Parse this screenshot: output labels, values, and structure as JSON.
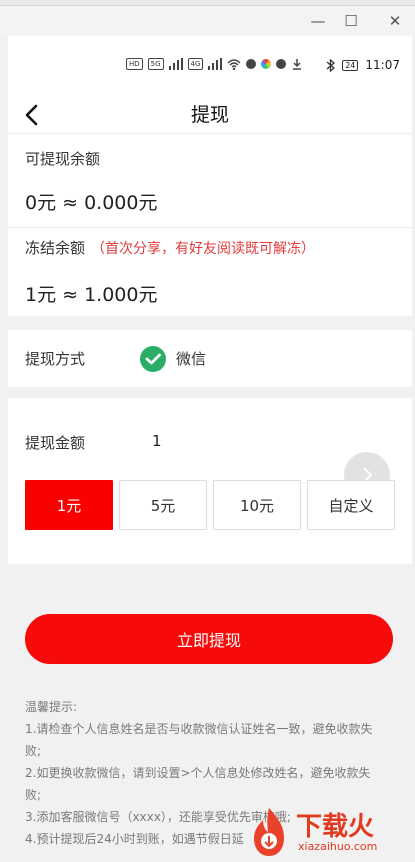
{
  "window": {
    "minimize": "—",
    "maximize": "☐",
    "close": "✕"
  },
  "status_bar": {
    "hd": "HD",
    "net1": "5G",
    "net2": "4G",
    "battery": "24",
    "time": "11:07"
  },
  "nav": {
    "title": "提现"
  },
  "balance": {
    "available_label": "可提现余额",
    "available_value": "0元 ≈ 0.000元",
    "frozen_label": "冻结余额",
    "frozen_note": "（首次分享，有好友阅读既可解冻）",
    "frozen_value": "1元 ≈ 1.000元"
  },
  "method": {
    "label": "提现方式",
    "value": "微信",
    "icon": "wechat-icon",
    "icon_color": "#2aae67"
  },
  "amount": {
    "label": "提现金额",
    "value": "1",
    "options": [
      "1元",
      "5元",
      "10元",
      "自定义"
    ],
    "selected_index": 0
  },
  "submit_label": "立即提现",
  "tips": {
    "title": "温馨提示:",
    "items": [
      "1.请检查个人信息姓名是否与收款微信认证姓名一致，避免收款失败;",
      "2.如更换收款微信，请到设置>个人信息处修改姓名，避免收款失败;",
      "3.添加客服微信号（xxxx），还能享受优先审核哦;",
      "4.预计提现后24小时到账，如遇节假日延"
    ]
  },
  "watermark": {
    "brand": "下载火",
    "domain": "xiazaihuo.com"
  },
  "colors": {
    "accent": "#fb0000",
    "note_red": "#e23b3b"
  }
}
